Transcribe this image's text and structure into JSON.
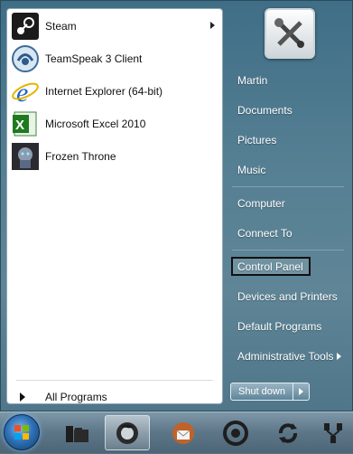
{
  "programs": [
    {
      "label": "Steam",
      "icon": "steam-icon",
      "has_submenu": true
    },
    {
      "label": "TeamSpeak 3 Client",
      "icon": "teamspeak-icon",
      "has_submenu": false
    },
    {
      "label": "Internet Explorer (64-bit)",
      "icon": "internet-explorer-icon",
      "has_submenu": false
    },
    {
      "label": "Microsoft Excel 2010",
      "icon": "excel-icon",
      "has_submenu": false
    },
    {
      "label": "Frozen Throne",
      "icon": "frozen-throne-icon",
      "has_submenu": false
    }
  ],
  "all_programs_label": "All Programs",
  "right_menu": {
    "user": "Martin",
    "documents": "Documents",
    "pictures": "Pictures",
    "music": "Music",
    "computer": "Computer",
    "connect_to": "Connect To",
    "control_panel": "Control Panel",
    "devices_printers": "Devices and Printers",
    "default_programs": "Default Programs",
    "admin_tools": "Administrative Tools"
  },
  "shutdown_label": "Shut down",
  "taskbar_items": [
    "windows-explorer-icon",
    "firefox-icon",
    "thunderbird-icon",
    "chrome-icon",
    "sync-icon",
    "network-icon"
  ],
  "colors": {
    "accent": "#3f6e86",
    "selected_outline": "#111111"
  }
}
